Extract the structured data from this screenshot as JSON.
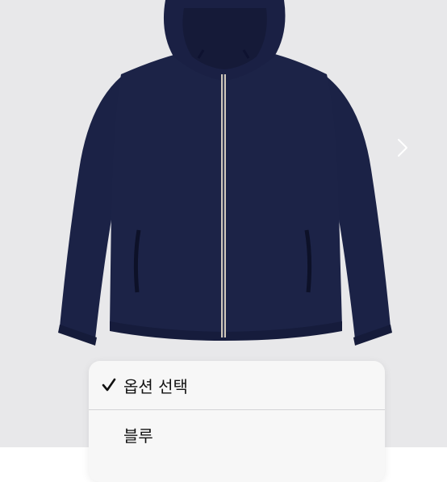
{
  "image": {
    "subject": "navy-hooded-zip-jacket",
    "accent": "#1b2246",
    "background": "#e8e8ea",
    "next_icon": "chevron-right-icon"
  },
  "option_menu": {
    "items": [
      {
        "label": "옵션 선택",
        "selected": true,
        "icon": "checkmark-icon"
      },
      {
        "label": "블루",
        "selected": false
      }
    ]
  }
}
